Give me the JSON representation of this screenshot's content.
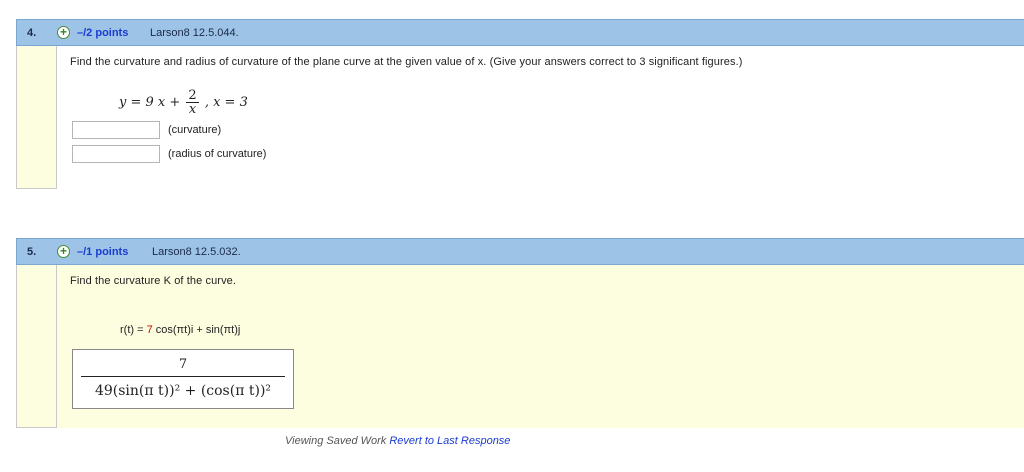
{
  "q4": {
    "number": "4.",
    "points": "–/2 points",
    "ref": "Larson8 12.5.044.",
    "prompt": "Find the curvature and radius of curvature of the plane curve at the given value of x. (Give your answers correct to 3 significant figures.)",
    "equation": {
      "lhs": "y = 9 x +",
      "frac_num": "2",
      "frac_den": "x",
      "rhs": ",  x = 3"
    },
    "fields": [
      {
        "value": "",
        "label": "(curvature)"
      },
      {
        "value": "",
        "label": "(radius of curvature)"
      }
    ]
  },
  "q5": {
    "number": "5.",
    "points": "–/1 points",
    "ref": "Larson8 12.5.032.",
    "prompt": "Find the curvature K of the curve.",
    "equation": {
      "lhs": "r(t)  =  ",
      "coef": "7",
      "rest": " cos(πt)i  +  sin(πt)j"
    },
    "answer": {
      "numerator": "7",
      "denominator": "49(sin(π t))² + (cos(π t))²"
    },
    "footer": {
      "text": "Viewing Saved Work",
      "link": "Revert to Last Response"
    }
  },
  "icons": {
    "expand": "plus-circle-icon"
  },
  "colors": {
    "header": "#9dc3e6",
    "body": "#fdfde0",
    "points": "#1a3ccf",
    "coef": "#d10000"
  }
}
